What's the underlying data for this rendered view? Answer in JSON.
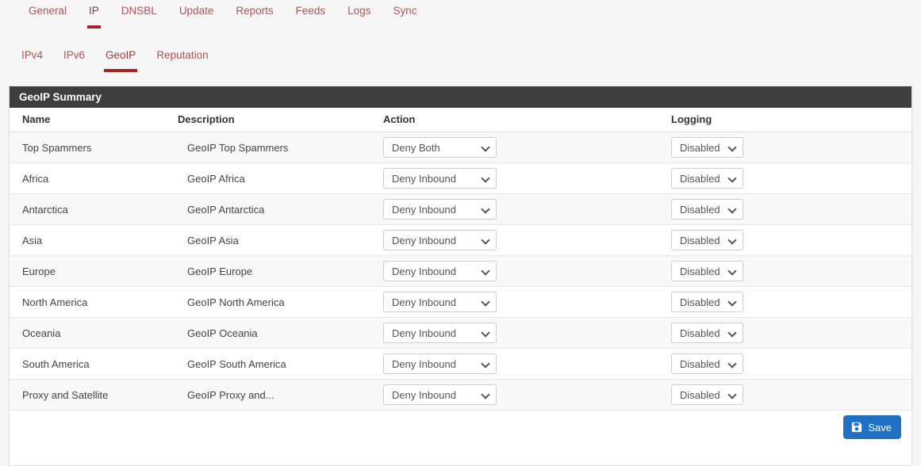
{
  "theme": {
    "tab_color": "#b5504f",
    "tab_active_color": "#a33634",
    "tab_underline": "#a32524",
    "panel_heading_bg": "#3e3e3e",
    "save_button_bg": "#2071c4",
    "page_bg": "#f6f6f6"
  },
  "nav_primary": {
    "items": [
      {
        "label": "General",
        "active": false
      },
      {
        "label": "IP",
        "active": true
      },
      {
        "label": "DNSBL",
        "active": false
      },
      {
        "label": "Update",
        "active": false
      },
      {
        "label": "Reports",
        "active": false
      },
      {
        "label": "Feeds",
        "active": false
      },
      {
        "label": "Logs",
        "active": false
      },
      {
        "label": "Sync",
        "active": false
      }
    ]
  },
  "nav_secondary": {
    "items": [
      {
        "label": "IPv4",
        "active": false
      },
      {
        "label": "IPv6",
        "active": false
      },
      {
        "label": "GeoIP",
        "active": true
      },
      {
        "label": "Reputation",
        "active": false
      }
    ]
  },
  "panel": {
    "title": "GeoIP Summary",
    "columns": {
      "name": "Name",
      "description": "Description",
      "action": "Action",
      "logging": "Logging"
    },
    "rows": [
      {
        "name": "Top Spammers",
        "description": "GeoIP Top Spammers",
        "action": "Deny Both",
        "logging": "Disabled"
      },
      {
        "name": "Africa",
        "description": "GeoIP Africa",
        "action": "Deny Inbound",
        "logging": "Disabled"
      },
      {
        "name": "Antarctica",
        "description": "GeoIP Antarctica",
        "action": "Deny Inbound",
        "logging": "Disabled"
      },
      {
        "name": "Asia",
        "description": "GeoIP Asia",
        "action": "Deny Inbound",
        "logging": "Disabled"
      },
      {
        "name": "Europe",
        "description": "GeoIP Europe",
        "action": "Deny Inbound",
        "logging": "Disabled"
      },
      {
        "name": "North America",
        "description": "GeoIP North America",
        "action": "Deny Inbound",
        "logging": "Disabled"
      },
      {
        "name": "Oceania",
        "description": "GeoIP Oceania",
        "action": "Deny Inbound",
        "logging": "Disabled"
      },
      {
        "name": "South America",
        "description": "GeoIP South America",
        "action": "Deny Inbound",
        "logging": "Disabled"
      },
      {
        "name": "Proxy and Satellite",
        "description": "GeoIP Proxy and...",
        "action": "Deny Inbound",
        "logging": "Disabled"
      }
    ],
    "save_label": "Save",
    "save_icon": "save-floppy-icon"
  }
}
